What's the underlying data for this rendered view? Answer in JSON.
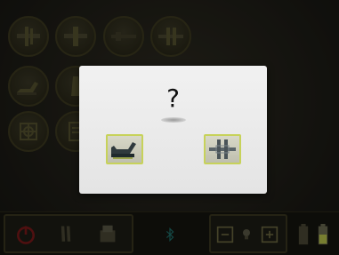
{
  "dialog": {
    "question": "?",
    "options": [
      {
        "icon": "chair-recline-icon"
      },
      {
        "icon": "clamp-tool-icon"
      }
    ]
  },
  "background": {
    "grid_icons": [
      "tool-1-icon",
      "tool-2-icon",
      "tool-3-icon",
      "tool-4-icon",
      "recline-icon",
      "arm-icon",
      "target-icon",
      "list-icon"
    ]
  },
  "bottom_bar": {
    "left_buttons": [
      "power-icon",
      "tool-holder-icon",
      "printer-icon"
    ],
    "center_icon": "bluetooth-icon",
    "light_controls": [
      "minus-icon",
      "light-bulb-icon",
      "plus-icon"
    ],
    "battery_icons": [
      "battery-1-icon",
      "battery-2-icon"
    ]
  },
  "colors": {
    "accent_frame": "#c7d25a",
    "power": "#8a1e1e",
    "bluetooth": "#1f7f7a",
    "dialog_bg": "#eeeeee"
  }
}
